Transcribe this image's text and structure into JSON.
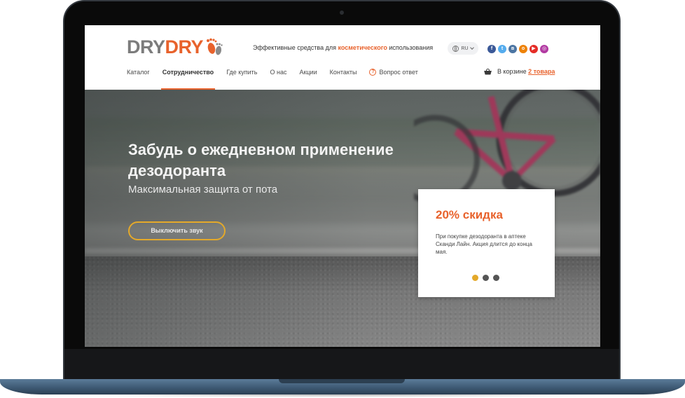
{
  "logo": {
    "part1": "DRY",
    "part2": "DRY"
  },
  "header": {
    "tagline_before": "Эффективные средства для",
    "tagline_accent": "косметического",
    "tagline_after": "использования",
    "language": "RU",
    "socials": [
      {
        "name": "facebook",
        "letter": "f",
        "color": "#3b5998"
      },
      {
        "name": "twitter",
        "letter": "t",
        "color": "#55acee"
      },
      {
        "name": "vk",
        "letter": "в",
        "color": "#4c75a3"
      },
      {
        "name": "odnoklassniki",
        "letter": "о",
        "color": "#ee8208"
      },
      {
        "name": "youtube",
        "letter": "▶",
        "color": "#e52d27"
      },
      {
        "name": "instagram",
        "letter": "◎",
        "color": "#b23aa2"
      }
    ]
  },
  "nav": {
    "items": [
      {
        "label": "Каталог"
      },
      {
        "label": "Сотрудничество",
        "active": true
      },
      {
        "label": "Где купить"
      },
      {
        "label": "О нас"
      },
      {
        "label": "Акции"
      },
      {
        "label": "Контакты"
      },
      {
        "label": "Вопрос ответ",
        "icon": "question-icon"
      }
    ]
  },
  "cart": {
    "prefix": "В корзине",
    "count": "2 товара"
  },
  "hero": {
    "title": "Забудь о ежедневном применение дезодоранта",
    "subtitle": "Максимальная защита от пота",
    "mute_button": "Выключить звук"
  },
  "promo": {
    "title": "20% скидка",
    "text": "При покупке дезодоранта в аптеке Сканди Лайн. Акция длится до конца мая.",
    "slides": 3,
    "active_slide": 1
  },
  "colors": {
    "accent": "#e8622c",
    "gold": "#e4a92a"
  }
}
